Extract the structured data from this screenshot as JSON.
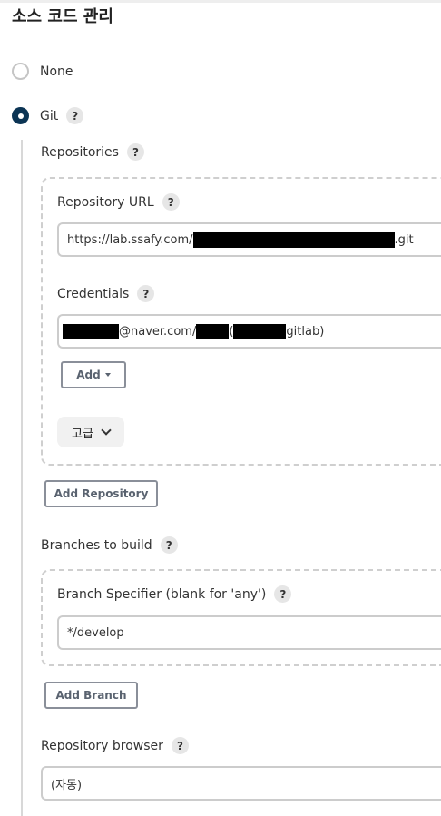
{
  "section": {
    "title": "소스 코드 관리"
  },
  "scm_options": {
    "none_label": "None",
    "git_label": "Git",
    "help_glyph": "?"
  },
  "repositories": {
    "label": "Repositories",
    "repo_url_label": "Repository URL",
    "repo_url_prefix": "https://lab.ssafy.com/",
    "repo_url_suffix": ".git",
    "credentials_label": "Credentials",
    "credentials_mid": "@naver.com/",
    "credentials_paren_open": " (",
    "credentials_suffix": "gitlab)",
    "add_label": "Add",
    "advanced_label": "고급",
    "add_repository_label": "Add Repository"
  },
  "branches": {
    "label": "Branches to build",
    "specifier_label": "Branch Specifier (blank for 'any')",
    "specifier_value": "*/develop",
    "add_branch_label": "Add Branch"
  },
  "browser": {
    "label": "Repository browser",
    "selected_value": "(자동)"
  },
  "colors": {
    "radio_checked": "#0b3454",
    "redaction": "#000000",
    "button_text": "#5a6370"
  }
}
